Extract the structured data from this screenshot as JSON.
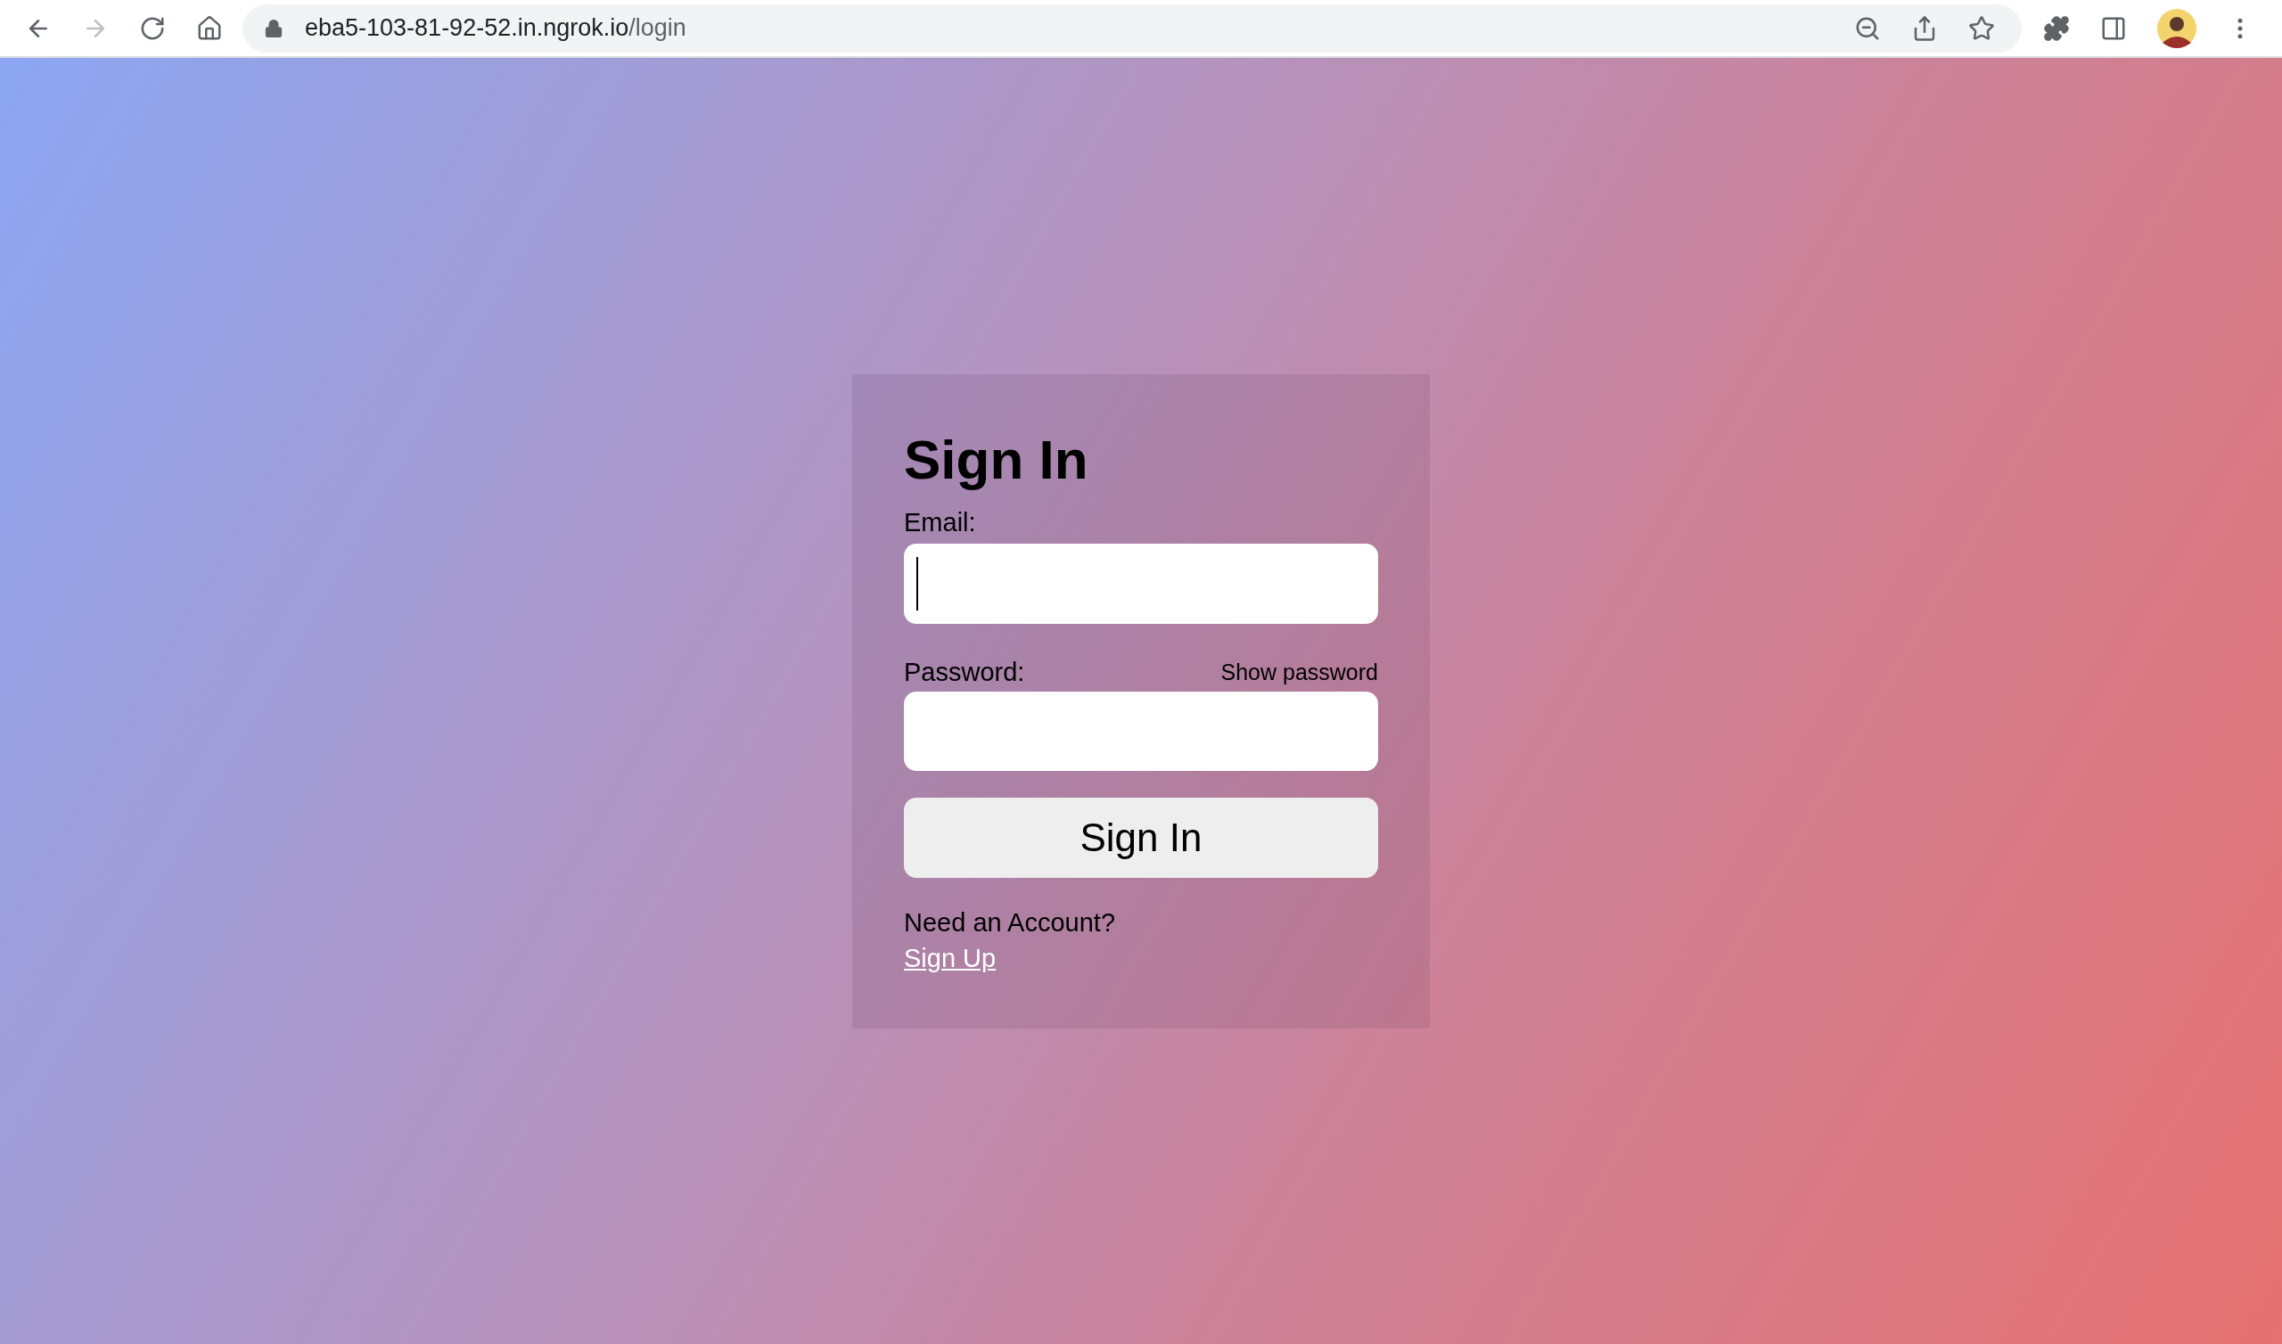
{
  "browser": {
    "back_enabled": true,
    "forward_enabled": false,
    "url_host": "eba5-103-81-92-52.in.ngrok.io",
    "url_path": "/login"
  },
  "form": {
    "title": "Sign In",
    "email": {
      "label": "Email:",
      "focused": true
    },
    "password": {
      "label": "Password:",
      "toggle": "Show password"
    },
    "submit": "Sign In",
    "prompt": "Need an Account?",
    "signup_link": "Sign Up"
  }
}
